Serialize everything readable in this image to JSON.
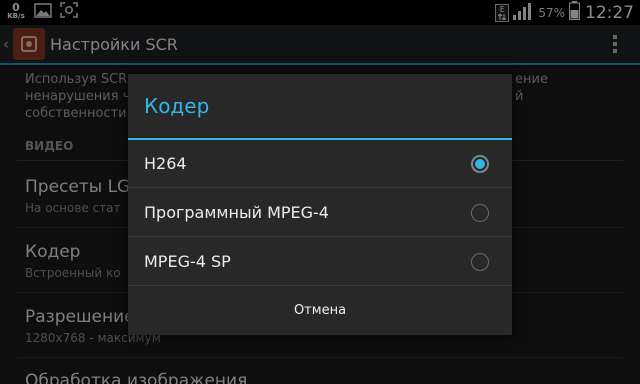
{
  "status_bar": {
    "net_speed_value": "0",
    "net_speed_unit": "KB/s",
    "network_type": "E",
    "battery_percent": "57%",
    "time": "12:27"
  },
  "action_bar": {
    "title": "Настройки SCR"
  },
  "background": {
    "description_lines": [
      "Используя SCR",
      "ение",
      "ненарушения чу",
      "й",
      "собственности."
    ],
    "section_header": "ВИДЕО",
    "prefs": [
      {
        "title": "Пресеты LG-",
        "summary": "На основе стат"
      },
      {
        "title": "Кодер",
        "summary": "Встроенный ко"
      },
      {
        "title": "Разрешение",
        "summary": "1280x768 - максимум"
      },
      {
        "title": "Обработка изображения",
        "summary": ""
      }
    ]
  },
  "dialog": {
    "title": "Кодер",
    "options": [
      {
        "label": "H264",
        "selected": true
      },
      {
        "label": "Программный MPEG-4",
        "selected": false
      },
      {
        "label": "MPEG-4 SP",
        "selected": false
      }
    ],
    "cancel_label": "Отмена"
  },
  "colors": {
    "accent": "#33b5e5",
    "dialog_bg": "#282828",
    "app_icon": "#8a3522"
  },
  "icons": [
    "image-icon",
    "screenshot-icon",
    "signal-icon",
    "battery-icon",
    "back-icon",
    "overflow-menu-icon"
  ]
}
